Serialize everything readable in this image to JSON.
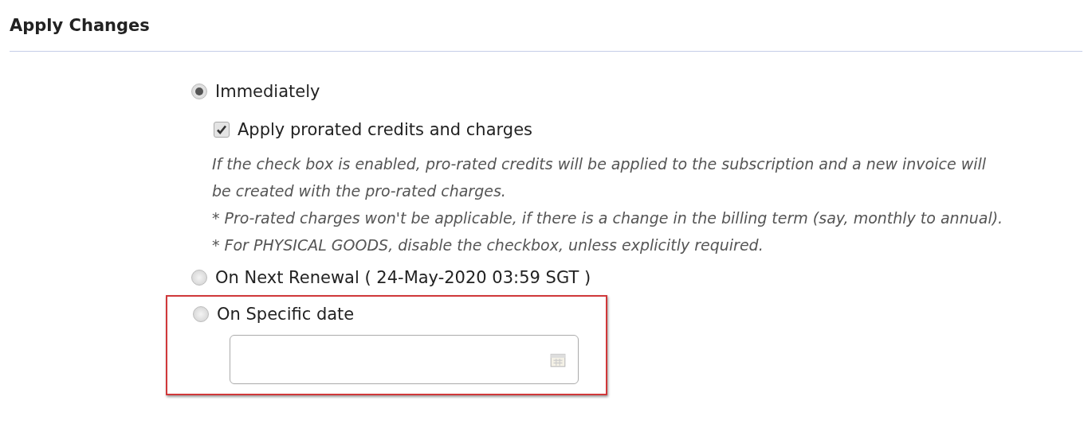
{
  "heading": "Apply Changes",
  "options": [
    {
      "kind": "plain",
      "label": "Immediately",
      "selected": true,
      "checkbox": {
        "label": "Apply prorated credits and charges",
        "checked": true
      },
      "notes": [
        "If the check box is enabled, pro-rated credits will be applied to the subscription and a new invoice will be created with the pro-rated charges.",
        "* Pro-rated charges won't be applicable, if there is a change in the billing term (say, monthly to annual).",
        "* For PHYSICAL GOODS, disable the checkbox, unless explicitly required."
      ]
    },
    {
      "kind": "plain",
      "label": "On Next Renewal ( 24-May-2020 03:59 SGT )",
      "selected": false
    },
    {
      "kind": "date",
      "label": "On Specific date",
      "selected": false,
      "highlighted": true
    }
  ]
}
